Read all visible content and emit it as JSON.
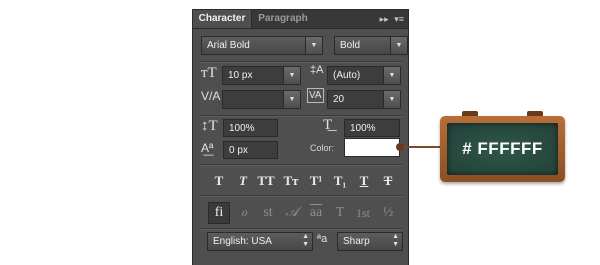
{
  "tabs": {
    "character": "Character",
    "paragraph": "Paragraph"
  },
  "panel_menu_icons": {
    "collapse": "▸▸",
    "menu": "▾≡"
  },
  "font": {
    "family": "Arial Bold",
    "style": "Bold"
  },
  "size": {
    "font_size": "10 px",
    "leading": "(Auto)"
  },
  "spacing": {
    "kerning": "",
    "tracking": "20"
  },
  "scale": {
    "vertical": "100%",
    "horizontal": "100%"
  },
  "baseline": {
    "shift": "0 px"
  },
  "color": {
    "label": "Color:",
    "value": "#FFFFFF"
  },
  "type_styles": [
    "T",
    "T",
    "TT",
    "Tт",
    "T¹",
    "T₁",
    "T",
    "T"
  ],
  "opentype": [
    "fi",
    "ℴ",
    "st",
    "𝒜",
    "aa",
    "T",
    "1st",
    "½"
  ],
  "language": "English: USA",
  "aa_icon": "ªa",
  "antialias": "Sharp",
  "callout": {
    "text": "# FFFFFF"
  }
}
